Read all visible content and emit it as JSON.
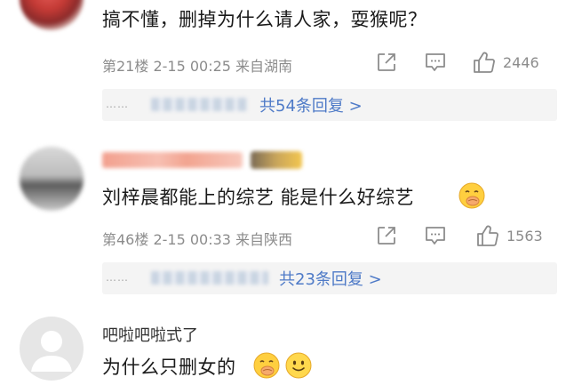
{
  "comments": [
    {
      "text": "搞不懂，删掉为什么请人家，耍猴呢？",
      "meta": "第21楼 2-15 00:25 来自湖南",
      "likes": "2446",
      "replies_link": "共54条回复 >"
    },
    {
      "text": "刘梓晨都能上的综艺  能是什么好综艺",
      "meta": "第46楼 2-15 00:33 来自陕西",
      "likes": "1563",
      "replies_link": "共23条回复 >"
    },
    {
      "username": "吧啦吧啦式了",
      "text": "为什么只删女的"
    }
  ],
  "reply_dots": "……",
  "icons": {
    "share": "share-icon",
    "comment": "comment-icon",
    "like": "thumbs-up-icon",
    "emoji_snicker": "snicker-emoji-icon",
    "emoji_smile": "smile-emoji-icon",
    "avatar_default": "default-avatar-icon"
  },
  "colors": {
    "link": "#4e7ac7",
    "meta": "#8c8c8c",
    "text": "#1a1a1a"
  }
}
